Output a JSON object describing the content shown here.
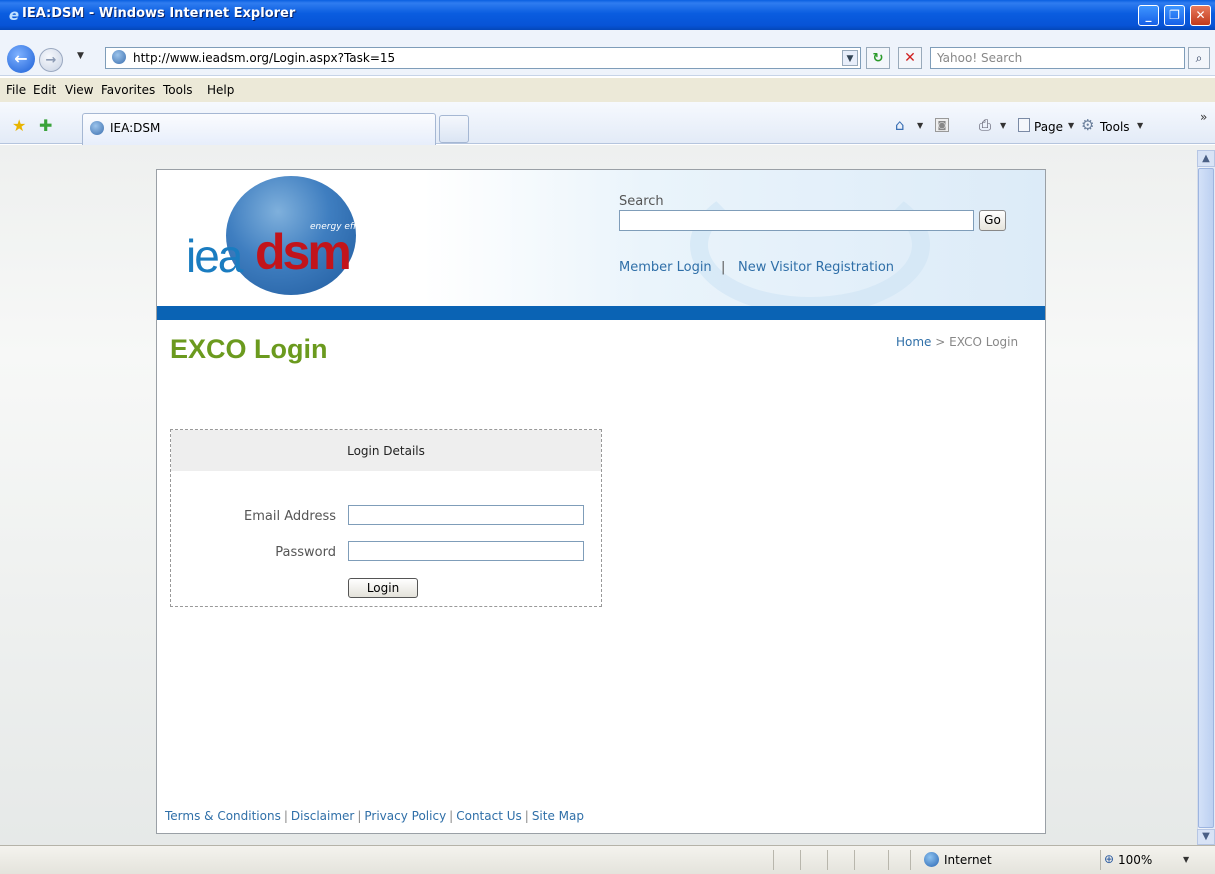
{
  "window": {
    "title": "IEA:DSM - Windows Internet Explorer"
  },
  "toolbar": {
    "address": "http://www.ieadsm.org/Login.aspx?Task=15",
    "search_placeholder": "Yahoo! Search"
  },
  "menu": [
    "File",
    "Edit",
    "View",
    "Favorites",
    "Tools",
    "Help"
  ],
  "tabs": {
    "active_label": "IEA:DSM"
  },
  "command_bar": {
    "page_label": "Page",
    "tools_label": "Tools"
  },
  "site": {
    "logo_iea": "iea",
    "logo_dsm": "dsm",
    "logo_tagline": "energy efficiency",
    "search_label": "Search",
    "go_label": "Go",
    "member_login": "Member Login",
    "link_sep": "|",
    "new_visitor": "New Visitor Registration"
  },
  "main": {
    "title": "EXCO Login",
    "breadcrumb": {
      "home": "Home",
      "sep": ">",
      "current": "EXCO Login"
    },
    "login": {
      "heading": "Login Details",
      "email_label": "Email Address",
      "email_value": "",
      "password_label": "Password",
      "password_value": "",
      "button": "Login"
    }
  },
  "footer": {
    "links": [
      "Terms & Conditions",
      "Disclaimer",
      "Privacy Policy",
      "Contact Us",
      "Site Map"
    ],
    "sep": "|"
  },
  "statusbar": {
    "zone": "Internet",
    "zoom": "100%"
  },
  "colors": {
    "titlebar": "#0a5de0",
    "brand_blue": "#0a63b4",
    "heading_green": "#6b9a1e",
    "link_blue": "#2f6fa8",
    "logo_red": "#c2141b"
  }
}
